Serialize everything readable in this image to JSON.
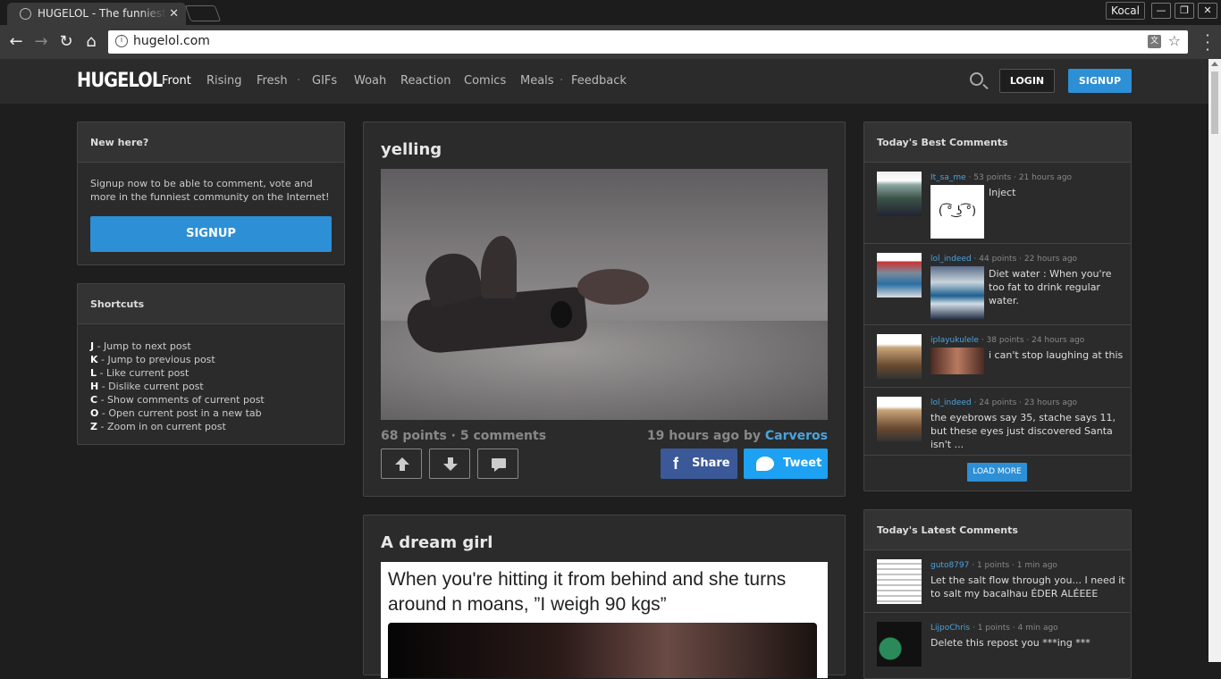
{
  "browser": {
    "tab_title": "HUGELOL - The funniest",
    "tab_close": "✕",
    "profile": "Kocal",
    "url": "hugelol.com",
    "win_min": "—",
    "win_max": "❐",
    "win_close": "✕"
  },
  "header": {
    "logo": "HUGELOL",
    "nav": [
      "Front",
      "Rising",
      "Fresh",
      "GIFs",
      "Woah",
      "Reaction",
      "Comics",
      "Meals",
      "Feedback"
    ],
    "login": "LOGIN",
    "signup": "SIGNUP"
  },
  "new_here": {
    "title": "New here?",
    "text": "Signup now to be able to comment, vote and more in the funniest community on the Internet!",
    "button": "SIGNUP"
  },
  "shortcuts": {
    "title": "Shortcuts",
    "items": [
      {
        "key": "J",
        "desc": " - Jump to next post"
      },
      {
        "key": "K",
        "desc": " - Jump to previous post"
      },
      {
        "key": "L",
        "desc": " - Like current post"
      },
      {
        "key": "H",
        "desc": " - Dislike current post"
      },
      {
        "key": "C",
        "desc": " - Show comments of current post"
      },
      {
        "key": "O",
        "desc": " - Open current post in a new tab"
      },
      {
        "key": "Z",
        "desc": " - Zoom in on current post"
      }
    ]
  },
  "post1": {
    "title": "yelling",
    "stats": "68 points · 5 comments",
    "time": "19 hours ago by ",
    "author": "Carveros",
    "share": "Share",
    "tweet": "Tweet"
  },
  "post2": {
    "title": "A dream girl",
    "caption": "When you're hitting it from behind and she turns around n moans, ”I weigh 90 kgs”"
  },
  "best_comments": {
    "title": "Today's Best Comments",
    "items": [
      {
        "user": "It_sa_me",
        "meta": " · 53 points · 21 hours ago",
        "text": "Inject"
      },
      {
        "user": "lol_indeed",
        "meta": " · 44 points · 22 hours ago",
        "text": "Diet water : When you're too fat to drink regular water."
      },
      {
        "user": "iplayukulele",
        "meta": " · 38 points · 24 hours ago",
        "text": "i can't stop laughing at this"
      },
      {
        "user": "lol_indeed",
        "meta": " · 24 points · 23 hours ago",
        "text": "the eyebrows say 35, stache says 11, but these eyes just discovered Santa isn't ..."
      }
    ],
    "load_more": "LOAD MORE"
  },
  "latest_comments": {
    "title": "Today's Latest Comments",
    "items": [
      {
        "user": "guto8797",
        "meta": " · 1 points · 1 min ago",
        "text": "Let the salt flow through you... I need it to salt my bacalhau ÉDER ALÉEEE"
      },
      {
        "user": "LijpoChris",
        "meta": " · 1 points · 4 min ago",
        "text": "Delete this repost you ***ing ***"
      }
    ]
  },
  "colors": {
    "accent": "#2d8fd5",
    "facebook": "#3b5998",
    "twitter": "#1da1f2",
    "bg": "#1e1e1e"
  }
}
